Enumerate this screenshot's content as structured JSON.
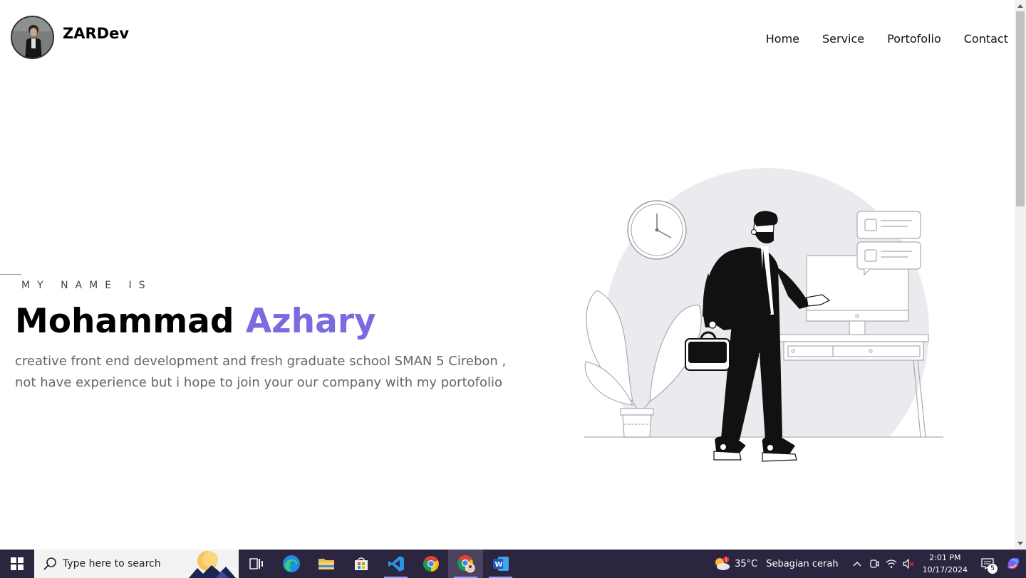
{
  "header": {
    "brand_name": "ZARDev",
    "nav": [
      "Home",
      "Service",
      "Portofolio",
      "Contact"
    ]
  },
  "hero": {
    "eyebrow": "MY NAME IS",
    "first_name": "Mohammad",
    "last_name": "Azhary",
    "description": "creative front end development and fresh graduate school SMAN 5 Cirebon , not have experience but i hope to join your our company with my portofolio"
  },
  "taskbar": {
    "search_placeholder": "Type here to search",
    "weather_temp": "35°C",
    "weather_desc": "Sebagian cerah",
    "time": "2:01 PM",
    "date": "10/17/2024",
    "notification_count": "5"
  },
  "colors": {
    "accent": "#7b6be0",
    "taskbar_bg": "#2b2540"
  }
}
